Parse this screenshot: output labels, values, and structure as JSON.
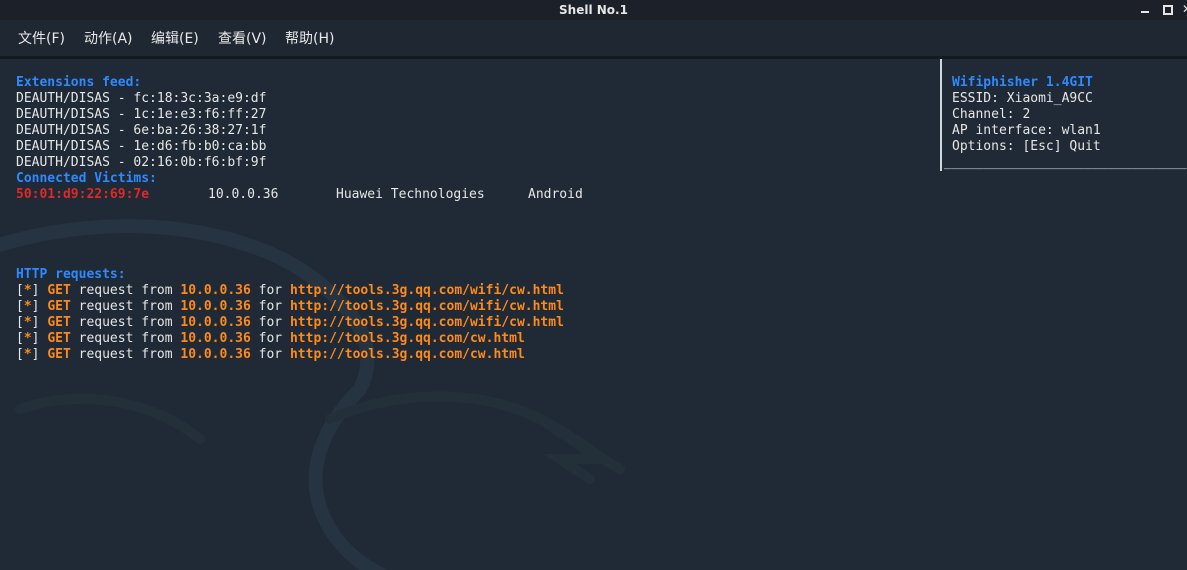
{
  "window": {
    "title": "Shell No.1"
  },
  "menu": {
    "items": [
      "文件(F)",
      "动作(A)",
      "编辑(E)",
      "查看(V)",
      "帮助(H)"
    ]
  },
  "extensions_feed": {
    "heading": "Extensions feed:",
    "lines": [
      "DEAUTH/DISAS - fc:18:3c:3a:e9:df",
      "DEAUTH/DISAS - 1c:1e:e3:f6:ff:27",
      "DEAUTH/DISAS - 6e:ba:26:38:27:1f",
      "DEAUTH/DISAS - 1e:d6:fb:b0:ca:bb",
      "DEAUTH/DISAS - 02:16:0b:f6:bf:9f"
    ]
  },
  "connected_victims": {
    "heading": "Connected Victims:",
    "rows": [
      {
        "mac": "50:01:d9:22:69:7e",
        "ip": "10.0.0.36",
        "vendor": "Huawei Technologies",
        "os": "Android"
      }
    ]
  },
  "http_requests": {
    "heading": "HTTP requests:",
    "bracket_open": "[",
    "star": "*",
    "bracket_close": "]",
    "method": "GET",
    "text_request_from": "request from",
    "text_for": "for",
    "rows": [
      {
        "ip": "10.0.0.36",
        "url": "http://tools.3g.qq.com/wifi/cw.html"
      },
      {
        "ip": "10.0.0.36",
        "url": "http://tools.3g.qq.com/wifi/cw.html"
      },
      {
        "ip": "10.0.0.36",
        "url": "http://tools.3g.qq.com/wifi/cw.html"
      },
      {
        "ip": "10.0.0.36",
        "url": "http://tools.3g.qq.com/cw.html"
      },
      {
        "ip": "10.0.0.36",
        "url": "http://tools.3g.qq.com/cw.html"
      }
    ]
  },
  "info_panel": {
    "title": "Wifiphisher 1.4GIT",
    "essid": "ESSID: Xiaomi_A9CC",
    "channel": "Channel: 2",
    "ap_interface": "AP interface: wlan1",
    "options": "Options: [Esc] Quit",
    "underline": "_______________________________"
  },
  "colors": {
    "heading_blue": "#2f89ff",
    "mac_red": "#e02828",
    "highlight_orange": "#ff8a1c",
    "background": "#1f2a36"
  }
}
